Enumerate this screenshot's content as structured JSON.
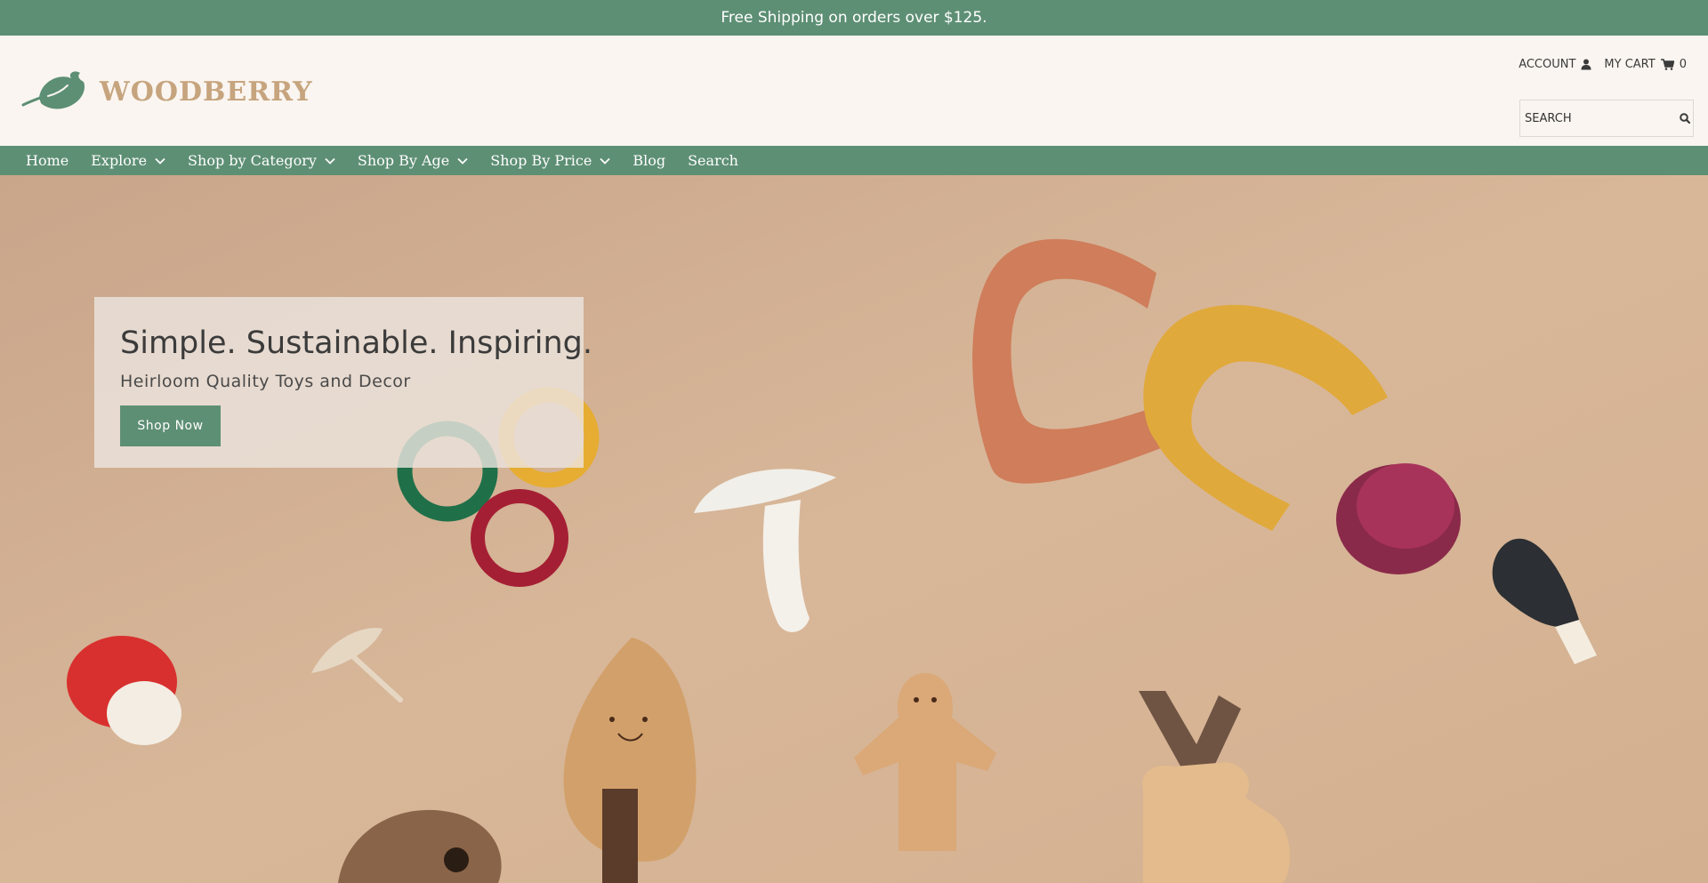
{
  "announcement": {
    "text": "Free Shipping on orders over $125."
  },
  "brand": {
    "name": "WOODBERRY",
    "logo_icon": "leaf-logo-icon"
  },
  "utility": {
    "account_label": "ACCOUNT",
    "account_icon": "user-icon",
    "cart_label": "MY CART",
    "cart_icon": "cart-icon",
    "cart_count": "0"
  },
  "search": {
    "placeholder": "SEARCH",
    "icon": "search-icon"
  },
  "nav": {
    "items": [
      {
        "label": "Home",
        "has_dropdown": false
      },
      {
        "label": "Explore",
        "has_dropdown": true
      },
      {
        "label": "Shop by Category",
        "has_dropdown": true
      },
      {
        "label": "Shop By Age",
        "has_dropdown": true
      },
      {
        "label": "Shop By Price",
        "has_dropdown": true
      },
      {
        "label": "Blog",
        "has_dropdown": false
      },
      {
        "label": "Search",
        "has_dropdown": false
      }
    ]
  },
  "hero": {
    "title": "Simple. Sustainable. Inspiring.",
    "subtitle": "Heirloom Quality Toys and Decor",
    "cta_label": "Shop Now"
  },
  "colors": {
    "brand_green": "#5d8f74",
    "logo_tan": "#c6a47e",
    "header_bg": "#faf5f0",
    "hero_bg": "#d4b294"
  }
}
